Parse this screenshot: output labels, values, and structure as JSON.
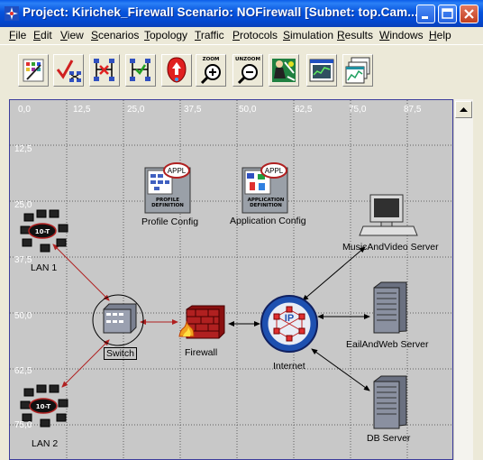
{
  "window": {
    "title": "Project: Kirichek_Firewall Scenario: NOFirewall  [Subnet: top.Cam..."
  },
  "menu": {
    "items": [
      {
        "pre": "",
        "u": "F",
        "post": "ile"
      },
      {
        "pre": "",
        "u": "E",
        "post": "dit"
      },
      {
        "pre": "",
        "u": "V",
        "post": "iew"
      },
      {
        "pre": "",
        "u": "S",
        "post": "cenarios"
      },
      {
        "pre": "",
        "u": "T",
        "post": "opology"
      },
      {
        "pre": "",
        "u": "T",
        "post": "raffic"
      },
      {
        "pre": "",
        "u": "P",
        "post": "rotocols"
      },
      {
        "pre": "",
        "u": "S",
        "post": "imulation"
      },
      {
        "pre": "",
        "u": "R",
        "post": "esults"
      },
      {
        "pre": "",
        "u": "W",
        "post": "indows"
      },
      {
        "pre": "",
        "u": "H",
        "post": "elp"
      }
    ]
  },
  "toolbar": {
    "zoom_text": "ZOOM",
    "unzoom_text": "UNZOOM",
    "tools": [
      "open-palette-icon",
      "verify-links-icon",
      "fail-node-icon",
      "recover-node-icon",
      "return-to-parent-icon",
      "zoom-in-icon",
      "zoom-out-icon",
      "configure-simulation-icon",
      "view-results-icon",
      "hide-graphs-icon"
    ]
  },
  "canvas": {
    "x_ticks": [
      "0,0",
      "12,5",
      "25,0",
      "37,5",
      "50,0",
      "62,5",
      "75,0",
      "87,5"
    ],
    "y_ticks": [
      "12,5",
      "25,0",
      "37,5",
      "50,0",
      "62,5",
      "75,0"
    ],
    "nodes": {
      "profile_config": "Profile Config",
      "application_config": "Application Config",
      "music_server": "MusicAndVideo Server",
      "email_server": "EailAndWeb Server",
      "db_server": "DB Server",
      "lan1": "LAN 1",
      "lan2": "LAN 2",
      "switch": "Switch",
      "firewall": "Firewall",
      "internet": "Internet"
    },
    "icon_text": {
      "appl": "APPL",
      "profile_def_1": "PROFILE",
      "profile_def_2": "DEFINITION",
      "app_def_1": "APPLICATION",
      "app_def_2": "DEFINITION",
      "lan_badge": "10-T",
      "ip": "IP"
    }
  },
  "colors": {
    "title_bar": "#0653dc",
    "workspace_bg": "#c8c8c8",
    "link_red": "#b02020",
    "link_black": "#000000"
  }
}
